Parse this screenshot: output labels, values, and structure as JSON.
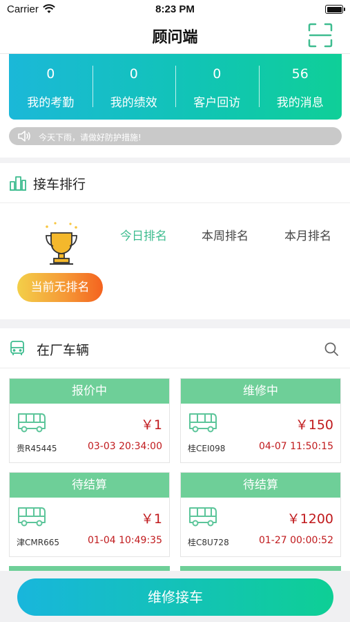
{
  "status_bar": {
    "carrier": "Carrier",
    "time": "8:23 PM"
  },
  "nav": {
    "title": "顾问端"
  },
  "stats": [
    {
      "value": "0",
      "label": "我的考勤"
    },
    {
      "value": "0",
      "label": "我的绩效"
    },
    {
      "value": "0",
      "label": "客户回访"
    },
    {
      "value": "56",
      "label": "我的消息"
    }
  ],
  "notice": {
    "text": "今天下雨，请做好防护措施!"
  },
  "ranking": {
    "title": "接车排行",
    "tabs": [
      "今日排名",
      "本周排名",
      "本月排名"
    ],
    "active_tab": 0,
    "empty_label": "当前无排名"
  },
  "vehicles": {
    "title": "在厂车辆",
    "cards": [
      {
        "status": "报价中",
        "price": "￥1",
        "plate": "贵R45445",
        "time": "03-03 20:34:00"
      },
      {
        "status": "维修中",
        "price": "￥150",
        "plate": "桂CEI098",
        "time": "04-07 11:50:15"
      },
      {
        "status": "待结算",
        "price": "￥1",
        "plate": "津CMR665",
        "time": "01-04 10:49:35"
      },
      {
        "status": "待结算",
        "price": "￥1200",
        "plate": "桂C8U728",
        "time": "01-27 00:00:52"
      }
    ]
  },
  "bottom": {
    "button_label": "维修接车"
  },
  "colors": {
    "accent_green": "#3dbc8f",
    "card_header": "#6ecf98",
    "price_red": "#c0191c"
  }
}
